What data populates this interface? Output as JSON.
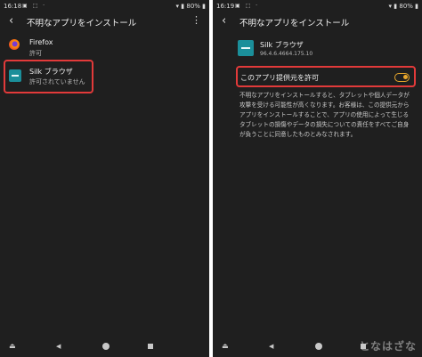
{
  "left_screen": {
    "status": {
      "time": "16:18",
      "icons": "▣ ⬚ ·",
      "right": "▾ ▮ 80% ▮"
    },
    "title": "不明なアプリをインストール",
    "more_icon": "⋮",
    "apps": [
      {
        "name": "Firefox",
        "status": "許可",
        "icon": "firefox-icon"
      },
      {
        "name": "Silk ブラウザ",
        "status": "許可されていません",
        "icon": "silk-icon"
      }
    ]
  },
  "right_screen": {
    "status": {
      "time": "16:19",
      "icons": "▣ ⬚ ·",
      "right": "▾ ▮ 80% ▮"
    },
    "title": "不明なアプリをインストール",
    "app": {
      "name": "Silk ブラウザ",
      "version": "96.4.6.4664.175.10"
    },
    "toggle_label": "このアプリ提供元を許可",
    "toggle_on": true,
    "warning": "不明なアプリをインストールすると、タブレットや個人データが攻撃を受ける可能性が高くなります。お客様は、この提供元からアプリをインストールすることで、アプリの使用によって生じるタブレットの損傷やデータの損失についての責任をすべてご自身が負うことに同意したものとみなされます。"
  },
  "watermark": "となはざな",
  "accent_color": "#e8a72c",
  "highlight_color": "#e23a3a"
}
